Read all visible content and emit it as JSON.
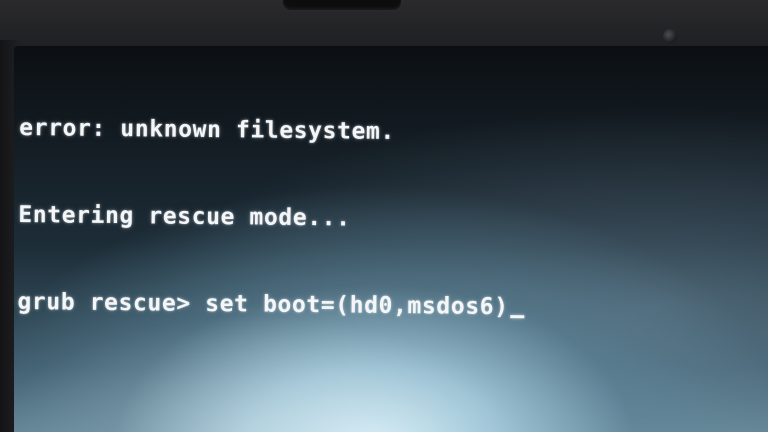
{
  "terminal": {
    "lines": [
      "error: unknown filesystem.",
      "Entering rescue mode..."
    ],
    "prompt": "grub rescue>",
    "command": "set boot=(hd0,msdos6)"
  },
  "colors": {
    "text": "#f4f6f8",
    "screen_dark": "#0b0f13",
    "screen_glare": "#d7f0fa",
    "bezel": "#1a1a1c"
  }
}
